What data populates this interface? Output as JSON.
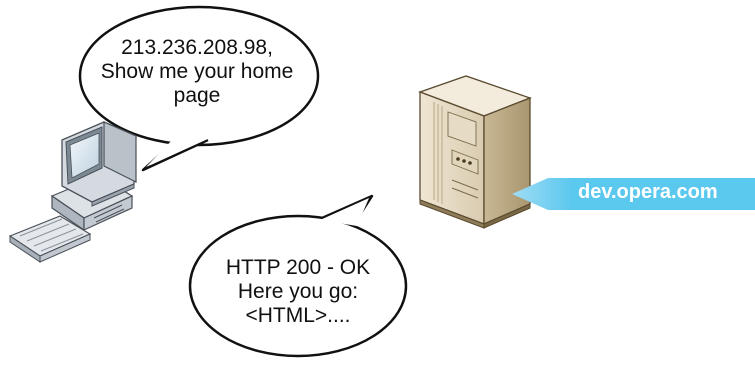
{
  "request_bubble": {
    "lines": [
      "213.236.208.98,",
      "Show me your home",
      "page"
    ]
  },
  "response_bubble": {
    "lines": [
      "HTTP 200 - OK",
      "Here you go:",
      "<HTML>...."
    ]
  },
  "server_label": {
    "text": "dev.opera.com",
    "color": "#5bc8ee"
  },
  "icons": {
    "client": "desktop-computer-icon",
    "server": "server-tower-icon"
  }
}
